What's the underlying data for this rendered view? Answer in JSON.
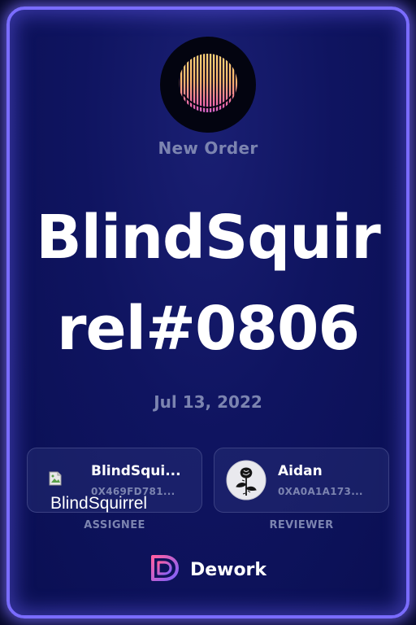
{
  "header": {
    "avatar_icon": "striped-sunset-circle-icon",
    "subtitle": "New Order"
  },
  "title": "BlindSquirrel#0806",
  "date": "Jul 13, 2022",
  "assignee": {
    "name": "BlindSqui...",
    "address": "0X469FD781...",
    "avatar_alt": "BlindSquirrel",
    "role_label": "ASSIGNEE",
    "avatar_icon": "broken-image-icon"
  },
  "reviewer": {
    "name": "Aidan",
    "address": "0XA0A1A173...",
    "role_label": "REVIEWER",
    "avatar_icon": "rose-icon"
  },
  "brand": {
    "name": "Dework",
    "icon": "dework-logo-icon"
  },
  "colors": {
    "frame_border": "#7a6cff",
    "background": "#0f1460",
    "muted_text": "#7c84b0",
    "accent_gradient": [
      "#ff5fa2",
      "#7b61ff"
    ]
  }
}
